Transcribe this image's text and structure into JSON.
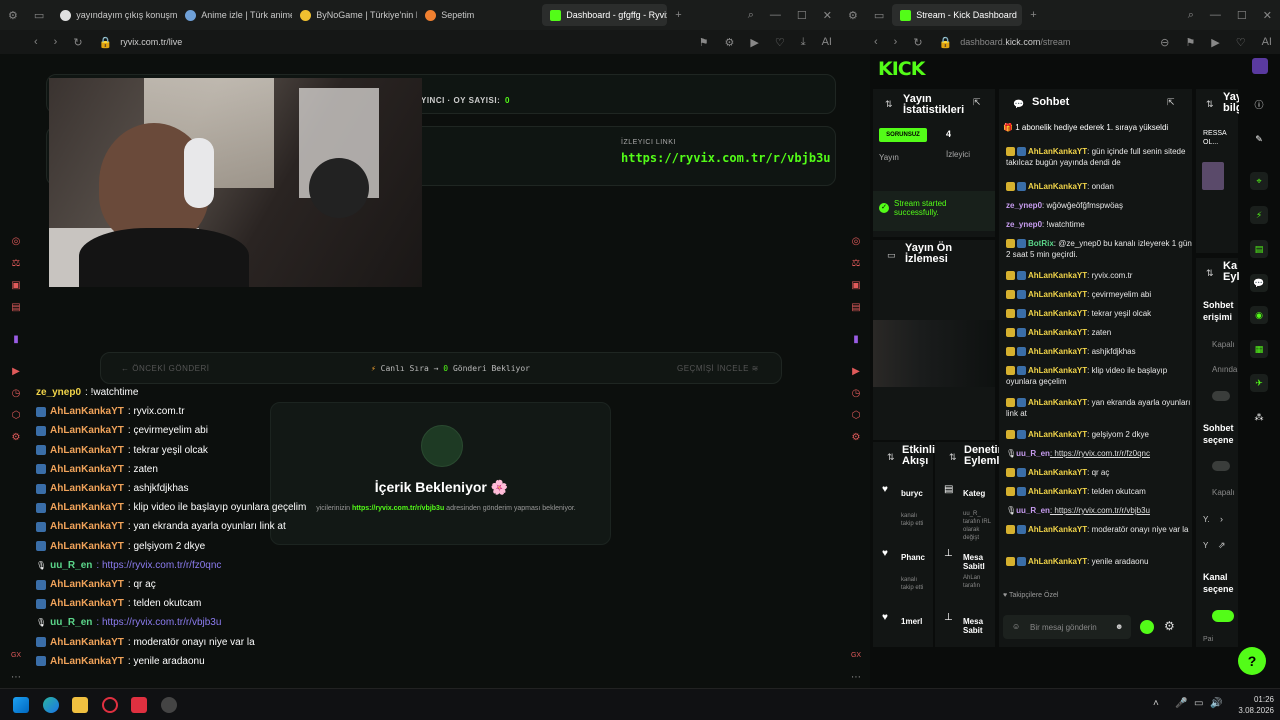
{
  "left_browser": {
    "tabs": [
      {
        "label": "yayındayım çıkış konuşmas",
        "color": "#e0e0e0"
      },
      {
        "label": "Anime izle | Türk anime tv",
        "color": "#6fa0d8"
      },
      {
        "label": "ByNoGame | Türkiye'nin En",
        "color": "#f0c030"
      },
      {
        "label": "Sepetim",
        "color": "#f08030"
      },
      {
        "label": "Dashboard - gfgffg - Ryvix",
        "color": "#53fc18"
      }
    ],
    "url": "ryvix.com.tr/live",
    "header_fragment": "YINCI · OY SAYISI:",
    "vote_count": "0",
    "viewer_link_label": "İZLEYICI LINKI",
    "viewer_link": "https://ryvix.com.tr/r/vbjb3u",
    "prev_button": "ÖNCEKİ GÖNDERİ",
    "queue_status": "Canlı Sıra →",
    "queue_count": "0",
    "queue_suffix": "Gönderi Bekliyor",
    "history_button": "GEÇMİŞİ İNCELE",
    "waiting_title": "İçerik Bekleniyor 🌸",
    "waiting_desc_pre": "yicilerinizin",
    "waiting_desc_link": "https://ryvix.com.tr/r/vbjb3u",
    "waiting_desc_post": "adresinden gönderim yapması bekleniyor.",
    "chat": [
      {
        "user": "ze_ynep0",
        "msg": ": !watchtime",
        "type": "y"
      },
      {
        "user": "AhLanKankaYT",
        "msg": ": ryvix.com.tr",
        "type": "o"
      },
      {
        "user": "AhLanKankaYT",
        "msg": ": çevirmeyelim abi",
        "type": "o"
      },
      {
        "user": "AhLanKankaYT",
        "msg": ": tekrar yeşil olcak",
        "type": "o"
      },
      {
        "user": "AhLanKankaYT",
        "msg": ": zaten",
        "type": "o"
      },
      {
        "user": "AhLanKankaYT",
        "msg": ": ashjkfdjkhas",
        "type": "o"
      },
      {
        "user": "AhLanKankaYT",
        "msg": ": klip video ile başlayıp oyunlara geçelim",
        "type": "o"
      },
      {
        "user": "AhLanKankaYT",
        "msg": ": yan ekranda ayarla oyunları link at",
        "type": "o"
      },
      {
        "user": "AhLanKankaYT",
        "msg": ": gelşiyom 2 dkye",
        "type": "o"
      },
      {
        "user": "uu_R_en",
        "msg": ": https://ryvix.com.tr/r/fz0qnc",
        "type": "g"
      },
      {
        "user": "AhLanKankaYT",
        "msg": ": qr aç",
        "type": "o"
      },
      {
        "user": "AhLanKankaYT",
        "msg": ": telden okutcam",
        "type": "o"
      },
      {
        "user": "uu_R_en",
        "msg": ": https://ryvix.com.tr/r/vbjb3u",
        "type": "g"
      },
      {
        "user": "AhLanKankaYT",
        "msg": ": moderatör onayı niye var la",
        "type": "o"
      },
      {
        "user": "AhLanKankaYT",
        "msg": ": yenile aradaonu",
        "type": "o"
      }
    ]
  },
  "right_browser": {
    "tab_label": "Stream - Kick Dashboard",
    "url_pre": "dashboard.",
    "url_main": "kick.com",
    "url_post": "/stream",
    "logo": "KICK",
    "stats_title": "Yayın İstatistikleri",
    "stats_badge": "SORUNSUZ",
    "stats_badge_label": "Yayın",
    "viewers_value": "4",
    "viewers_label": "İzleyici",
    "stream_started": "Stream started successfully.",
    "preview_title": "Yayın Ön İzlemesi",
    "activity_title": "Etkinlik Akışı",
    "mod_title": "Denetim Eylemleri",
    "chat_title": "Sohbet",
    "gift_banner": "1 abonelik hediye ederek 1. sıraya yükseldi",
    "followers_only": "Takipçilere Özel",
    "chat_placeholder": "Bir mesaj gönderin",
    "activity": [
      {
        "name": "buryc",
        "sub": "kanalı takip etti"
      },
      {
        "name": "Phanc",
        "sub": "kanalı takip etti"
      },
      {
        "name": "1merl",
        "sub": ""
      }
    ],
    "mod": [
      {
        "name": "Kateg",
        "sub": "uu_R_ tarafın IRL olarak değişt"
      },
      {
        "name": "Mesa Sabitl",
        "sub": "AhLan tarafın"
      },
      {
        "name": "Mesa Sabit",
        "sub": ""
      }
    ],
    "right_cols": {
      "info_title": "Yayı bilgi",
      "info_sub": "RESSA OL...",
      "channel_title": "Ka Eyl",
      "chat_access": "Sohbet erişimi",
      "closed": "Kapalı",
      "instant": "Anında",
      "chat_options": "Sohbet seçene",
      "closed2": "Kapalı",
      "y1": "Y.",
      "y2": "Y",
      "channel_options": "Kanal seçene",
      "pai": "Pai"
    },
    "chat": [
      {
        "user": "AhLanKankaYT",
        "msg": ": gün içinde full senin sitede takılcaz bugün yayında dendi de",
        "t": "y"
      },
      {
        "user": "AhLanKankaYT",
        "msg": ": ondan",
        "t": "y"
      },
      {
        "user": "ze_ynep0",
        "msg": ": wğöwğeöfğfmspwöaş",
        "t": "p"
      },
      {
        "user": "ze_ynep0",
        "msg": ": !watchtime",
        "t": "p"
      },
      {
        "user": "BotRix",
        "msg": ": @ze_ynep0 bu kanalı izleyerek 1 gün 2 saat 5 min geçirdi.",
        "t": "g"
      },
      {
        "user": "AhLanKankaYT",
        "msg": ": ryvix.com.tr",
        "t": "y"
      },
      {
        "user": "AhLanKankaYT",
        "msg": ": çevirmeyelim abi",
        "t": "y"
      },
      {
        "user": "AhLanKankaYT",
        "msg": ": tekrar yeşil olcak",
        "t": "y"
      },
      {
        "user": "AhLanKankaYT",
        "msg": ": zaten",
        "t": "y"
      },
      {
        "user": "AhLanKankaYT",
        "msg": ": ashjkfdjkhas",
        "t": "y"
      },
      {
        "user": "AhLanKankaYT",
        "msg": ": klip video ile başlayıp oyunlara geçelim",
        "t": "y"
      },
      {
        "user": "AhLanKankaYT",
        "msg": ": yan ekranda ayarla oyunları link at",
        "t": "y"
      },
      {
        "user": "AhLanKankaYT",
        "msg": ": gelşiyom 2 dkye",
        "t": "y"
      },
      {
        "user": "uu_R_en",
        "msg": ": https://ryvix.com.tr/r/fz0qnc",
        "t": "l"
      },
      {
        "user": "AhLanKankaYT",
        "msg": ": qr aç",
        "t": "y"
      },
      {
        "user": "AhLanKankaYT",
        "msg": ": telden okutcam",
        "t": "y"
      },
      {
        "user": "uu_R_en",
        "msg": ": https://ryvix.com.tr/r/vbjb3u",
        "t": "l"
      },
      {
        "user": "AhLanKankaYT",
        "msg": ": moderatör onayı niye var la",
        "t": "y"
      },
      {
        "user": "AhLanKankaYT",
        "msg": ": yenile aradaonu",
        "t": "y"
      }
    ]
  },
  "taskbar": {
    "time": "01:26",
    "date": "3.08.2026"
  }
}
